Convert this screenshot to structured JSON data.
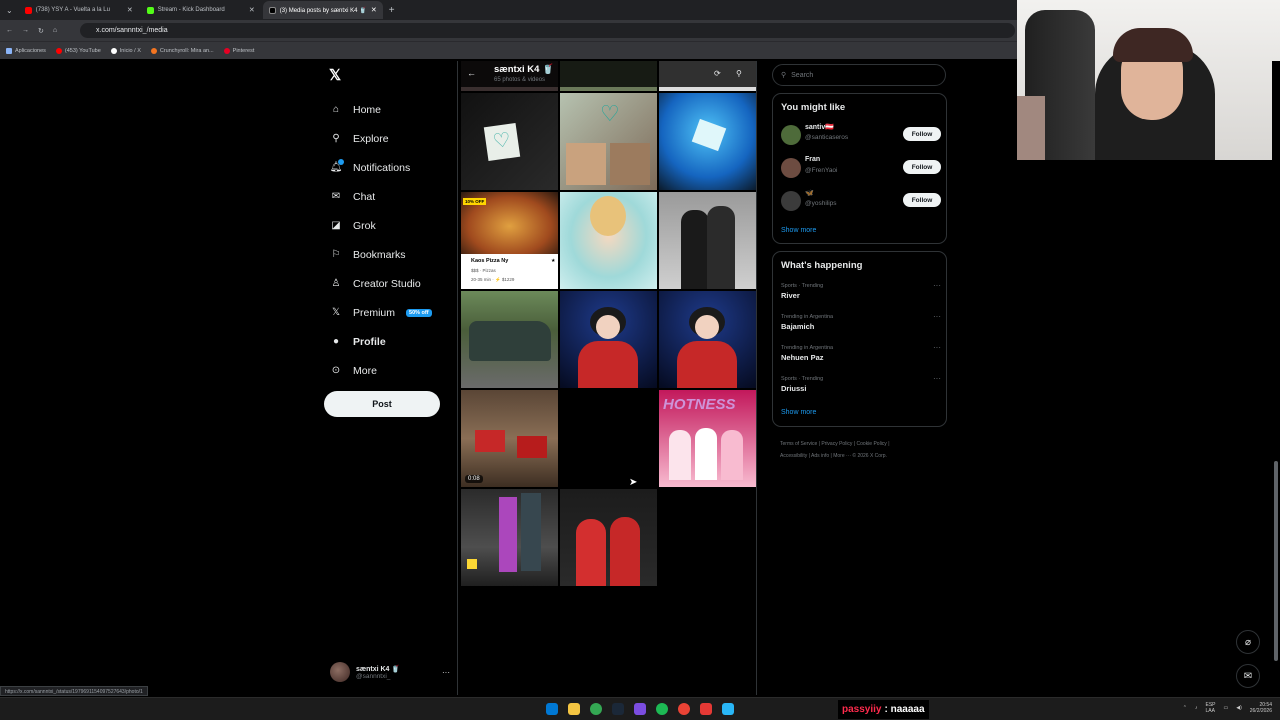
{
  "browser": {
    "tabs": [
      {
        "label": "(738) YSY A - Vuelta a la Lu",
        "active": false
      },
      {
        "label": "Stream - Kick Dashboard",
        "active": false
      },
      {
        "label": "(3) Media posts by sæntxi K4 🥤",
        "active": true
      }
    ],
    "url": "x.com/sannntxi_/media",
    "bookmarks": [
      "Aplicaciones",
      "(453) YouTube",
      "Inicio / X",
      "Crunchyroll: Mira an...",
      "Pinterest"
    ],
    "status_url": "https://x.com/sannntxi_/status/1979691154097527643/photo/1"
  },
  "sidebar": {
    "items": [
      {
        "label": "Home",
        "icon": "home-icon"
      },
      {
        "label": "Explore",
        "icon": "search-icon"
      },
      {
        "label": "Notifications",
        "icon": "bell-icon"
      },
      {
        "label": "Chat",
        "icon": "mail-icon"
      },
      {
        "label": "Grok",
        "icon": "grok-icon"
      },
      {
        "label": "Bookmarks",
        "icon": "bookmark-icon"
      },
      {
        "label": "Creator Studio",
        "icon": "creator-icon"
      },
      {
        "label": "Premium",
        "icon": "x-icon",
        "badge": "50% off"
      },
      {
        "label": "Profile",
        "icon": "person-icon"
      },
      {
        "label": "More",
        "icon": "more-icon"
      }
    ],
    "post_label": "Post",
    "account": {
      "name": "sæntxi K4 🥤",
      "handle": "@sannntxi_"
    }
  },
  "main": {
    "title": "sæntxi K4 🥤",
    "subtitle": "65 photos & videos",
    "video_duration": "0:08",
    "pizza_card": {
      "badge": "10% OFF",
      "name": "Kaos Pizza Ny",
      "price": "$$$ · Pizzas",
      "eta": "20-35 min · ⚡ $1229"
    },
    "graffiti_text": "HOTNESS"
  },
  "right": {
    "search_placeholder": "Search",
    "you_might_like": {
      "title": "You might like",
      "users": [
        {
          "name": "santiv🇦🇹",
          "handle": "@santicaseros",
          "follow": "Follow",
          "color": "#4e6b3a"
        },
        {
          "name": "Fran",
          "handle": "@FrenYaoi",
          "follow": "Follow",
          "color": "#6d4c41"
        },
        {
          "name": "🦋",
          "handle": "@yoshilips",
          "follow": "Follow",
          "color": "#3b3b3b"
        }
      ],
      "show_more": "Show more"
    },
    "whats_happening": {
      "title": "What's happening",
      "trends": [
        {
          "meta": "Sports · Trending",
          "topic": "River"
        },
        {
          "meta": "Trending in Argentina",
          "topic": "Bajamich"
        },
        {
          "meta": "Trending in Argentina",
          "topic": "Nehuen Paz"
        },
        {
          "meta": "Sports · Trending",
          "topic": "Driussi"
        }
      ],
      "show_more": "Show more"
    },
    "footer": [
      "Terms of Service",
      "Privacy Policy",
      "Cookie Policy",
      "Accessibility",
      "Ads info",
      "More ···",
      "© 2026 X Corp."
    ]
  },
  "stream_chat": {
    "user": "passyiiy",
    "message": ": naaaaa"
  },
  "taskbar": {
    "lang": "ESP",
    "region": "LAA",
    "time": "20:54",
    "date": "26/2/2026"
  },
  "colors": {
    "accent": "#1d9bf0",
    "background": "#000000",
    "border": "#2f3336",
    "muted": "#71767b"
  }
}
